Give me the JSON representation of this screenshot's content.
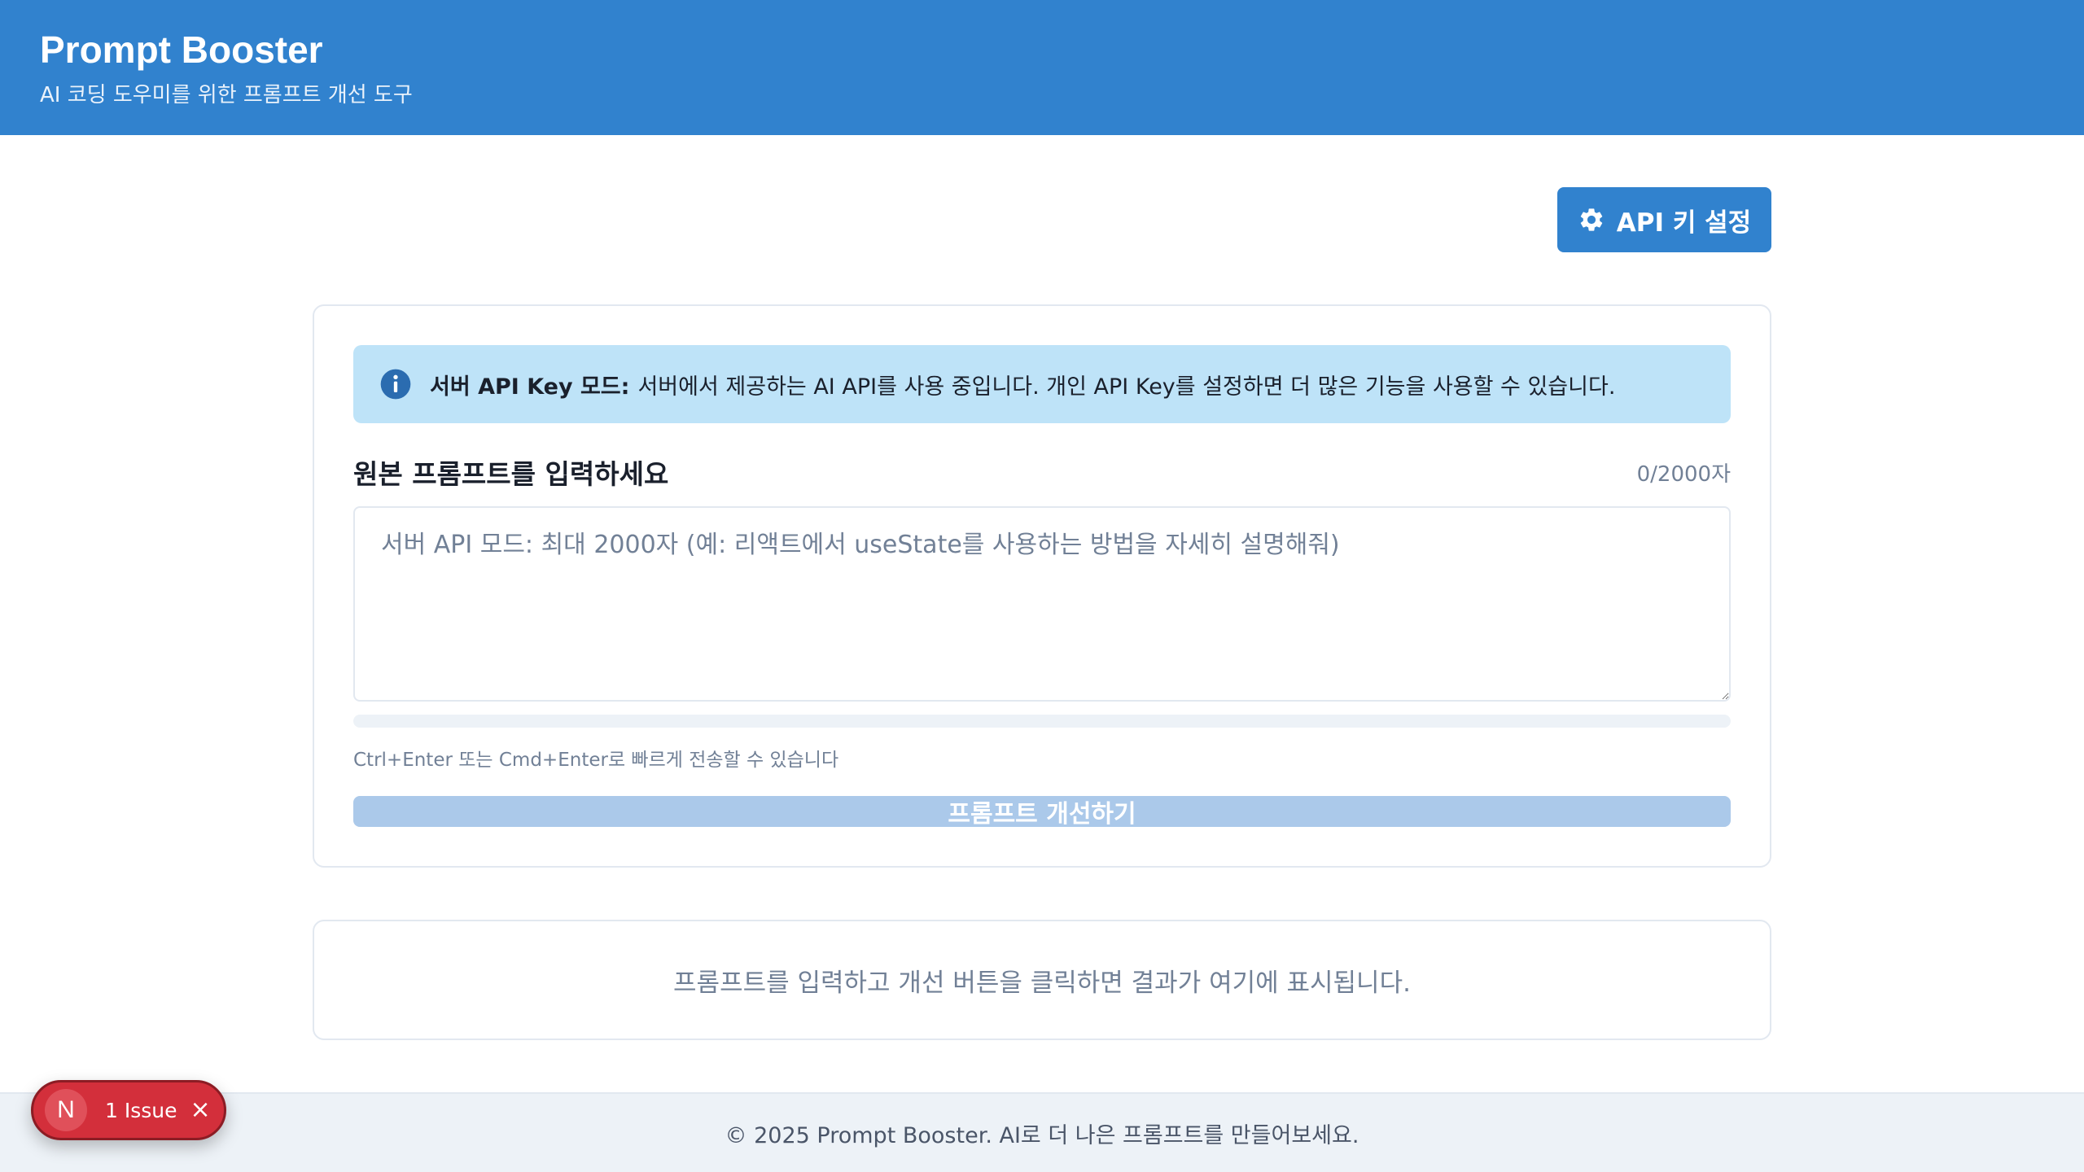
{
  "header": {
    "title": "Prompt Booster",
    "subtitle": "AI 코딩 도우미를 위한 프롬프트 개선 도구"
  },
  "api_button": {
    "icon": "gear-icon",
    "label": "API 키 설정"
  },
  "info_banner": {
    "icon": "info-icon",
    "bold": "서버 API Key 모드:",
    "text": "서버에서 제공하는 AI API를 사용 중입니다. 개인 API Key를 설정하면 더 많은 기능을 사용할 수 있습니다."
  },
  "prompt_form": {
    "label": "원본 프롬프트를 입력하세요",
    "char_count": "0/2000자",
    "placeholder": "서버 API 모드: 최대 2000자 (예: 리액트에서 useState를 사용하는 방법을 자세히 설명해줘)",
    "value": "",
    "progress": 0,
    "hint": "Ctrl+Enter 또는 Cmd+Enter로 빠르게 전송할 수 있습니다",
    "submit_label": "프롬프트 개선하기"
  },
  "result": {
    "empty_message": "프롬프트를 입력하고 개선 버튼을 클릭하면 결과가 여기에 표시됩니다."
  },
  "footer": {
    "text": "© 2025 Prompt Booster. AI로 더 나은 프롬프트를 만들어보세요."
  },
  "issue_indicator": {
    "badge": "N",
    "label": "1 Issue",
    "close": "×"
  },
  "colors": {
    "primary": "#3182ce",
    "info_bg": "#bee3f8",
    "disabled_button": "#abc9ea",
    "issue_red": "#d32f3b"
  }
}
